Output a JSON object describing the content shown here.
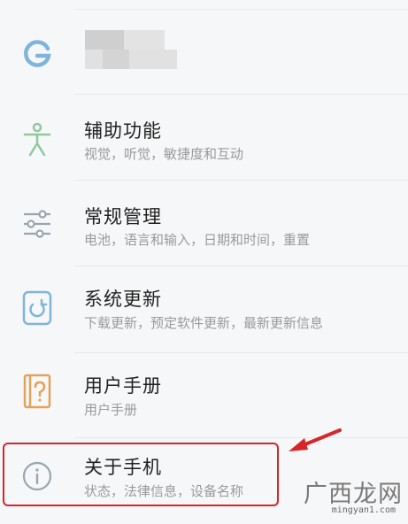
{
  "settings": {
    "google": {
      "icon": "google-g-icon"
    },
    "accessibility": {
      "title": "辅助功能",
      "subtitle": "视觉，听觉，敏捷度和互动",
      "icon": "accessibility-icon"
    },
    "general": {
      "title": "常规管理",
      "subtitle": "电池，语言和输入，日期和时间，重置",
      "icon": "sliders-icon"
    },
    "update": {
      "title": "系统更新",
      "subtitle": "下载更新，预定软件更新，最新更新信息",
      "icon": "refresh-icon"
    },
    "manual": {
      "title": "用户手册",
      "subtitle": "用户手册",
      "icon": "help-book-icon"
    },
    "about": {
      "title": "关于手机",
      "subtitle": "状态，法律信息，设备名称",
      "icon": "info-icon"
    }
  },
  "colors": {
    "icon_blue": "#7fb5d9",
    "icon_green": "#8fc9a0",
    "icon_orange": "#e3a25b",
    "icon_gray": "#9aa5ad",
    "highlight": "#d6262a"
  },
  "watermark": {
    "text": "广西龙网",
    "url": "mingyan1.com"
  }
}
